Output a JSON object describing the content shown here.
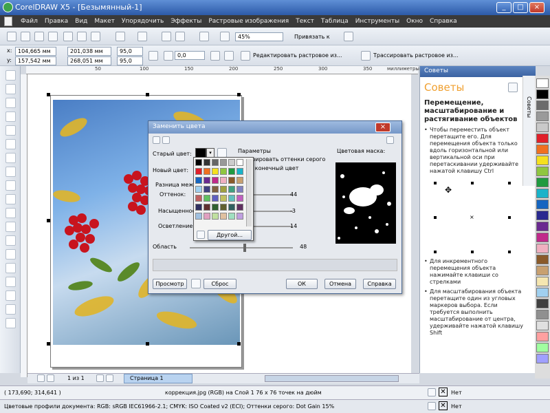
{
  "window": {
    "title": "CorelDRAW X5 - [Безымянный-1]"
  },
  "menu": [
    "Файл",
    "Правка",
    "Вид",
    "Макет",
    "Упорядочить",
    "Эффекты",
    "Растровые изображения",
    "Текст",
    "Таблица",
    "Инструменты",
    "Окно",
    "Справка"
  ],
  "toolbar": {
    "zoom": "45%",
    "snap": "Привязать к"
  },
  "propbar": {
    "x": "104,665 мм",
    "y": "157,542 мм",
    "w": "201,038 мм",
    "h": "268,051 мм",
    "sx": "95,0",
    "sy": "95,0",
    "angle": "0,0",
    "edit_bitmap": "Редактировать растровое из...",
    "trace_bitmap": "Трассировать растровое из..."
  },
  "ruler": {
    "ticks": [
      "50",
      "100",
      "150",
      "200",
      "250",
      "300",
      "350"
    ],
    "unit": "миллиметры"
  },
  "docker": {
    "header": "Советы",
    "title": "Советы",
    "heading": "Перемещение, масштабирование и растягивание объектов",
    "tips": [
      "Чтобы переместить объект перетащите его. Для перемещения объекта только вдоль горизонтальной или вертикальной оси при перетаскивании удерживайте нажатой клавишу Ctrl",
      "Для инкрементного перемещения объекта нажимайте клавиши со стрелками",
      "Для масштабирования объекта перетащите один из угловых маркеров выбора. Если требуется выполнить масштабирование от центра, удерживайте нажатой клавишу Shift"
    ],
    "side_tabs": "Советы"
  },
  "dialog": {
    "title": "Заменить цвета",
    "old_color": "Старый цвет:",
    "new_color": "Новый цвет:",
    "params": "Параметры",
    "ignore_gray": "Игнорировать оттенки серого",
    "single_target": "Один конечный цвет",
    "diff": "Разница между цв...",
    "hue": "Оттенок:",
    "hue_val": "44",
    "sat": "Насыщенность:",
    "sat_val": "-3",
    "light": "Осветление:",
    "light_val": "14",
    "range": "Область",
    "range_val": "48",
    "mask": "Цветовая маска:",
    "other": "Другой...",
    "preview": "Просмотр",
    "reset": "Сброс",
    "ok": "ОК",
    "cancel": "Отмена",
    "help": "Справка"
  },
  "pagebar": {
    "count": "1 из 1",
    "tab": "Страница 1"
  },
  "status": {
    "coords": "( 173,690; 314,641 )",
    "info": "коррекция.jpg (RGB) на Слой 1 76 х 76 точек на дюйм",
    "profiles": "Цветовые профили документа: RGB: sRGB IEC61966-2.1; CMYK: ISO Coated v2 (ECI); Оттенки серого: Dot Gain 15%",
    "fill_none": "Нет",
    "outline_none": "Нет"
  },
  "palette_colors": [
    "#ffffff",
    "#000000",
    "#6b6b6b",
    "#9a9a9a",
    "#c9c9c9",
    "#e0202a",
    "#f07020",
    "#f5e01e",
    "#8fc640",
    "#1f9a40",
    "#19b3c9",
    "#1565c0",
    "#2a2a90",
    "#6a2a90",
    "#c02a8a",
    "#f0b0c0",
    "#8a5a2a",
    "#c8a070",
    "#f5e6b0",
    "#a0d0f0",
    "#404040",
    "#909090",
    "#e0e0e0",
    "#ffa0a0",
    "#a0ffa0",
    "#a0a0ff"
  ],
  "popup_colors": [
    "#000000",
    "#333333",
    "#666666",
    "#999999",
    "#cccccc",
    "#ffffff",
    "#e0202a",
    "#f07020",
    "#f5e01e",
    "#8fc640",
    "#1f9a40",
    "#19b3c9",
    "#1565c0",
    "#6a2a90",
    "#c02a8a",
    "#f0b0c0",
    "#8a5a2a",
    "#c8a070",
    "#a0d0f0",
    "#404080",
    "#806040",
    "#a0a040",
    "#40a080",
    "#8080c0",
    "#c06060",
    "#60c060",
    "#6060c0",
    "#c0c060",
    "#60c0c0",
    "#c060c0",
    "#303060",
    "#603030",
    "#306030",
    "#606030",
    "#306060",
    "#603060",
    "#a0c0e0",
    "#e0a0c0",
    "#c0e0a0",
    "#e0c0a0",
    "#a0e0c0",
    "#c0a0e0"
  ]
}
